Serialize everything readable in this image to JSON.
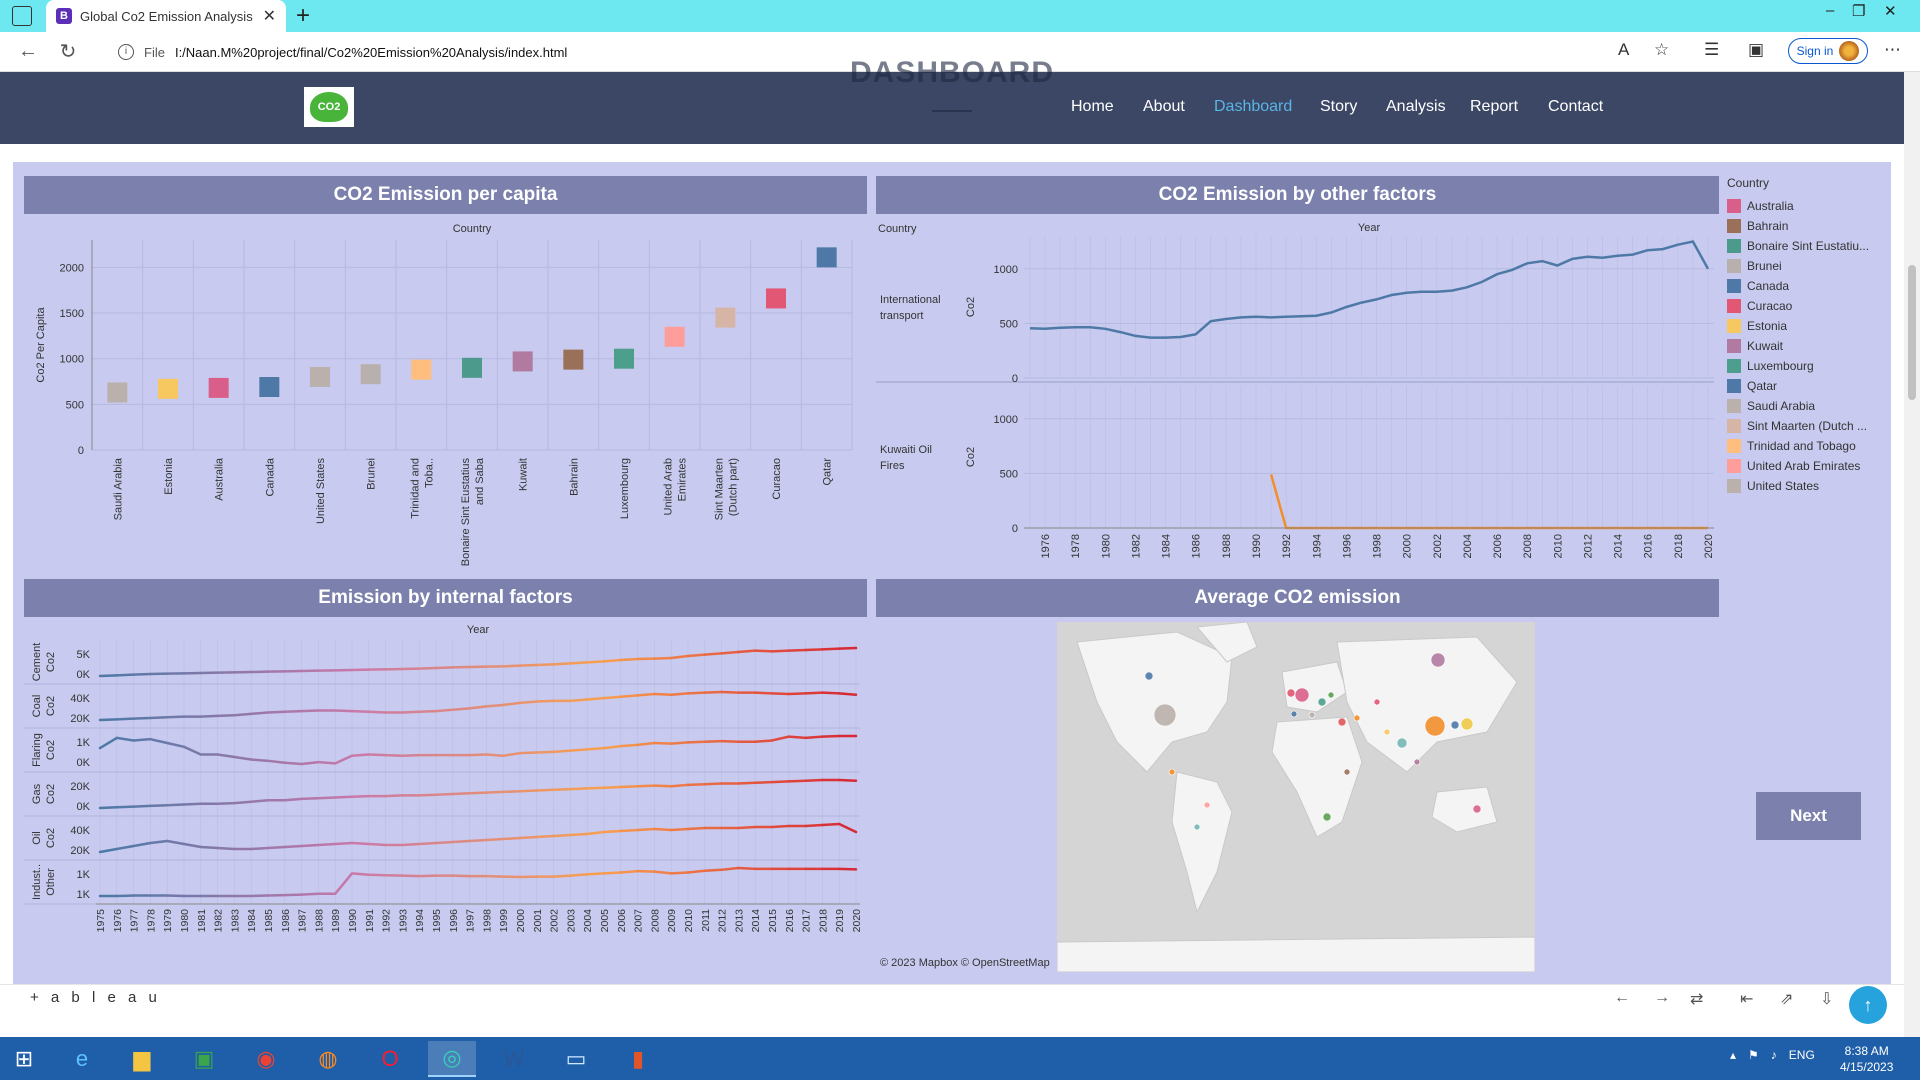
{
  "browser": {
    "tab_title": "Global Co2 Emission Analysis",
    "tab_favicon": "B",
    "url_scheme_label": "File",
    "url": "I:/Naan.M%20project/final/Co2%20Emission%20Analysis/index.html",
    "signin_label": "Sign in"
  },
  "site": {
    "ghost_heading": "DASHBOARD",
    "logo_text": "CO2",
    "nav": [
      {
        "label": "Home",
        "active": false
      },
      {
        "label": "About",
        "active": false
      },
      {
        "label": "Dashboard",
        "active": true
      },
      {
        "label": "Story",
        "active": false
      },
      {
        "label": "Analysis",
        "active": false
      },
      {
        "label": "Report",
        "active": false
      },
      {
        "label": "Contact",
        "active": false
      }
    ]
  },
  "dashboard": {
    "panel1_title": "CO2 Emission per capita",
    "panel2_title": "CO2 Emission by other factors",
    "panel3_title": "Emission by internal factors",
    "panel4_title": "Average CO2 emission",
    "legend": {
      "title": "Country",
      "items": [
        {
          "label": "Australia",
          "color": "#d95f8a"
        },
        {
          "label": "Bahrain",
          "color": "#9a7058"
        },
        {
          "label": "Bonaire Sint Eustatiu...",
          "color": "#4b9a8c"
        },
        {
          "label": "Brunei",
          "color": "#b8b0ac"
        },
        {
          "label": "Canada",
          "color": "#4e79a7"
        },
        {
          "label": "Curacao",
          "color": "#e15774"
        },
        {
          "label": "Estonia",
          "color": "#f6c85f"
        },
        {
          "label": "Kuwait",
          "color": "#b07aa1"
        },
        {
          "label": "Luxembourg",
          "color": "#4e9e8e"
        },
        {
          "label": "Qatar",
          "color": "#4e79a7"
        },
        {
          "label": "Saudi Arabia",
          "color": "#bab0ac"
        },
        {
          "label": "Sint Maarten (Dutch ...",
          "color": "#d7b5a6"
        },
        {
          "label": "Trinidad and Tobago",
          "color": "#ffbe7d"
        },
        {
          "label": "United Arab Emirates",
          "color": "#ff9d9a"
        },
        {
          "label": "United States",
          "color": "#bab0ac"
        }
      ]
    },
    "map_attribution": "© 2023 Mapbox © OpenStreetMap",
    "next_label": "Next"
  },
  "chart_data": [
    {
      "type": "scatter",
      "title": "CO2 Emission per capita",
      "xlabel": "Country",
      "ylabel": "Co2 Per Capita",
      "ylim": [
        0,
        2300
      ],
      "yticks": [
        0,
        500,
        1000,
        1500,
        2000
      ],
      "categories": [
        "Saudi Arabia",
        "Estonia",
        "Australia",
        "Canada",
        "United States",
        "Brunei",
        "Trinidad and Toba..",
        "Bonaire Sint Eustatius and Saba",
        "Kuwait",
        "Bahrain",
        "Luxembourg",
        "United Arab Emirates",
        "Sint Maarten (Dutch part)",
        "Curacao",
        "Qatar"
      ],
      "values": [
        630,
        670,
        680,
        690,
        800,
        830,
        880,
        900,
        970,
        990,
        1000,
        1240,
        1450,
        1660,
        2110
      ],
      "colors": [
        "#bab0ac",
        "#f6c85f",
        "#d95f8a",
        "#4e79a7",
        "#bab0ac",
        "#b8b0ac",
        "#ffbe7d",
        "#4b9a8c",
        "#b07aa1",
        "#9a7058",
        "#4e9e8e",
        "#ff9d9a",
        "#d7b5a6",
        "#e15774",
        "#4e79a7"
      ]
    },
    {
      "type": "line",
      "title": "CO2 Emission by other factors",
      "xlabel": "Year",
      "row_header": "Country",
      "ylabel": "Co2",
      "x": [
        1975,
        1976,
        1977,
        1978,
        1979,
        1980,
        1981,
        1982,
        1983,
        1984,
        1985,
        1986,
        1987,
        1988,
        1989,
        1990,
        1991,
        1992,
        1993,
        1994,
        1995,
        1996,
        1997,
        1998,
        1999,
        2000,
        2001,
        2002,
        2003,
        2004,
        2005,
        2006,
        2007,
        2008,
        2009,
        2010,
        2011,
        2012,
        2013,
        2014,
        2015,
        2016,
        2017,
        2018,
        2019,
        2020
      ],
      "xticks": [
        1976,
        1978,
        1980,
        1982,
        1984,
        1986,
        1988,
        1990,
        1992,
        1994,
        1996,
        1998,
        2000,
        2002,
        2004,
        2006,
        2008,
        2010,
        2012,
        2014,
        2016,
        2018,
        2020
      ],
      "rows": [
        {
          "label": "International transport",
          "ylim": [
            0,
            1300
          ],
          "yticks": [
            0,
            500,
            1000
          ],
          "series": [
            {
              "color": "#4e79a7",
              "values": [
                455,
                450,
                460,
                465,
                465,
                450,
                420,
                385,
                370,
                370,
                375,
                400,
                520,
                540,
                555,
                560,
                555,
                560,
                565,
                570,
                600,
                650,
                690,
                720,
                760,
                780,
                790,
                790,
                800,
                830,
                880,
                950,
                990,
                1050,
                1070,
                1030,
                1090,
                1110,
                1100,
                1120,
                1130,
                1170,
                1180,
                1220,
                1250,
                1000
              ]
            }
          ]
        },
        {
          "label": "Kuwaiti Oil Fires",
          "ylim": [
            0,
            1300
          ],
          "yticks": [
            0,
            500,
            1000
          ],
          "series": [
            {
              "color": "#f28e2b",
              "values": [
                null,
                null,
                null,
                null,
                null,
                null,
                null,
                null,
                null,
                null,
                null,
                null,
                null,
                null,
                null,
                null,
                490,
                0,
                0,
                0,
                0,
                0,
                0,
                0,
                0,
                0,
                0,
                0,
                0,
                0,
                0,
                0,
                0,
                0,
                0,
                0,
                0,
                0,
                0,
                0,
                0,
                0,
                0,
                0,
                0,
                0
              ]
            }
          ]
        }
      ]
    },
    {
      "type": "line",
      "title": "Emission by internal factors",
      "xlabel": "Year",
      "x": [
        1975,
        1976,
        1977,
        1978,
        1979,
        1980,
        1981,
        1982,
        1983,
        1984,
        1985,
        1986,
        1987,
        1988,
        1989,
        1990,
        1991,
        1992,
        1993,
        1994,
        1995,
        1996,
        1997,
        1998,
        1999,
        2000,
        2001,
        2002,
        2003,
        2004,
        2005,
        2006,
        2007,
        2008,
        2009,
        2010,
        2011,
        2012,
        2013,
        2014,
        2015,
        2016,
        2017,
        2018,
        2019,
        2020
      ],
      "rows": [
        {
          "label": "Co2 Cement",
          "yticks": [
            "0K",
            "5K"
          ],
          "values": [
            0,
            0.1,
            0.2,
            0.3,
            0.35,
            0.4,
            0.45,
            0.5,
            0.55,
            0.6,
            0.65,
            0.7,
            0.75,
            0.8,
            0.85,
            0.9,
            0.95,
            1.0,
            1.05,
            1.1,
            1.2,
            1.3,
            1.35,
            1.4,
            1.45,
            1.55,
            1.65,
            1.75,
            1.9,
            2.05,
            2.2,
            2.4,
            2.55,
            2.6,
            2.7,
            3.0,
            3.2,
            3.4,
            3.6,
            3.8,
            3.7,
            3.8,
            3.9,
            4.0,
            4.1,
            4.2
          ]
        },
        {
          "label": "Co2 Coal",
          "yticks": [
            "20K",
            "40K"
          ],
          "values": [
            0,
            0.1,
            0.2,
            0.3,
            0.4,
            0.5,
            0.5,
            0.6,
            0.7,
            0.9,
            1.1,
            1.2,
            1.3,
            1.4,
            1.4,
            1.3,
            1.2,
            1.1,
            1.1,
            1.2,
            1.3,
            1.5,
            1.7,
            2.0,
            2.2,
            2.5,
            2.7,
            2.8,
            2.8,
            3.0,
            3.2,
            3.4,
            3.6,
            3.8,
            3.7,
            3.9,
            4.0,
            4.1,
            4.0,
            4.0,
            3.9,
            3.8,
            3.9,
            4.0,
            3.9,
            3.7
          ]
        },
        {
          "label": "Co2 Flaring",
          "yticks": [
            "0K",
            "1K"
          ],
          "values": [
            2.0,
            3.6,
            3.2,
            3.4,
            2.8,
            2.2,
            1.0,
            1.0,
            0.6,
            0.2,
            0.0,
            -0.3,
            -0.5,
            -0.2,
            -0.4,
            0.8,
            1.0,
            0.9,
            0.8,
            0.9,
            0.9,
            0.9,
            0.9,
            1.0,
            0.8,
            1.2,
            1.3,
            1.4,
            1.6,
            1.8,
            2.0,
            2.3,
            2.5,
            2.8,
            2.7,
            2.9,
            3.0,
            3.1,
            3.0,
            3.0,
            3.2,
            3.8,
            3.6,
            3.8,
            3.9,
            3.9
          ]
        },
        {
          "label": "Co2 Gas",
          "yticks": [
            "0K",
            "20K"
          ],
          "values": [
            0,
            0.1,
            0.2,
            0.3,
            0.4,
            0.5,
            0.6,
            0.6,
            0.7,
            0.9,
            1.1,
            1.1,
            1.3,
            1.4,
            1.5,
            1.6,
            1.7,
            1.7,
            1.8,
            1.8,
            1.9,
            2.0,
            2.1,
            2.2,
            2.3,
            2.4,
            2.5,
            2.6,
            2.7,
            2.8,
            2.9,
            3.0,
            3.1,
            3.2,
            3.1,
            3.3,
            3.4,
            3.5,
            3.5,
            3.6,
            3.7,
            3.8,
            3.9,
            4.0,
            4.0,
            3.9
          ]
        },
        {
          "label": "Co2 Oil",
          "yticks": [
            "20K",
            "40K"
          ],
          "values": [
            0,
            0.3,
            0.6,
            0.9,
            1.1,
            0.8,
            0.5,
            0.4,
            0.3,
            0.3,
            0.4,
            0.5,
            0.6,
            0.7,
            0.8,
            0.9,
            0.8,
            0.7,
            0.7,
            0.8,
            0.9,
            1.0,
            1.1,
            1.2,
            1.3,
            1.4,
            1.5,
            1.6,
            1.7,
            1.8,
            2.0,
            2.1,
            2.2,
            2.3,
            2.2,
            2.3,
            2.4,
            2.4,
            2.4,
            2.5,
            2.5,
            2.6,
            2.6,
            2.7,
            2.8,
            2.0
          ]
        },
        {
          "label": "Other Indust..",
          "yticks": [
            "1K",
            "1K"
          ],
          "values": [
            0,
            0,
            0.1,
            0.1,
            0.1,
            0,
            0,
            0,
            0,
            0,
            0.1,
            0.2,
            0.3,
            0.5,
            0.5,
            5.0,
            4.7,
            4.6,
            4.5,
            4.4,
            4.5,
            4.5,
            4.4,
            4.4,
            4.3,
            4.2,
            4.3,
            4.3,
            4.5,
            4.8,
            5.0,
            5.2,
            5.5,
            5.4,
            5.0,
            5.2,
            5.6,
            5.8,
            6.2,
            6.0,
            6.0,
            6.0,
            6.0,
            6.0,
            6.0,
            5.9
          ]
        }
      ]
    }
  ],
  "footer": {
    "tableau_label": "+ a b l e a u"
  },
  "taskbar": {
    "language": "ENG",
    "time": "8:38 AM",
    "date": "4/15/2023"
  }
}
